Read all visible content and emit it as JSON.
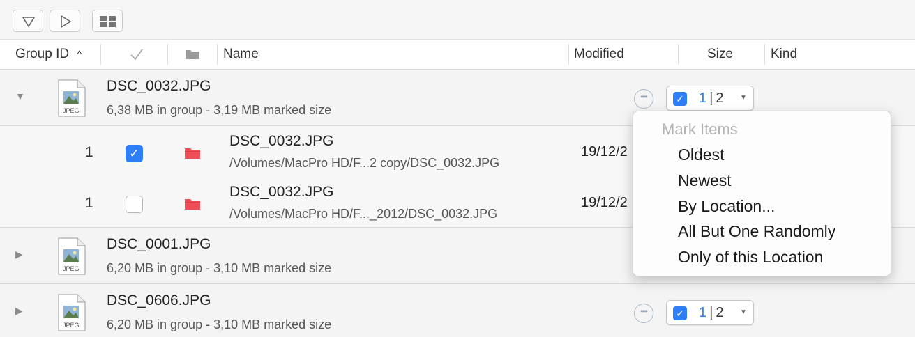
{
  "toolbar": {
    "buttons": [
      {
        "name": "filter-triangle-down-icon"
      },
      {
        "name": "play-triangle-right-icon"
      },
      {
        "name": "grid-view-icon"
      }
    ]
  },
  "header": {
    "group_id": "Group ID",
    "sort_indicator": "^",
    "check_icon": "checkmark-icon",
    "folder_icon": "folder-icon",
    "name": "Name",
    "modified": "Modified",
    "size": "Size",
    "kind": "Kind"
  },
  "groups": [
    {
      "name": "DSC_0032.JPG",
      "summary": "6,38 MB in group - 3,19 MB marked size",
      "expanded": true,
      "marked": "1",
      "separator": "|",
      "total": "2",
      "file_icon_label": "JPEG",
      "items": [
        {
          "group_id": "1",
          "checked": true,
          "name": "DSC_0032.JPG",
          "path": "/Volumes/MacPro HD/F...2 copy/DSC_0032.JPG",
          "modified": "19/12/2"
        },
        {
          "group_id": "1",
          "checked": false,
          "name": "DSC_0032.JPG",
          "path": "/Volumes/MacPro HD/F..._2012/DSC_0032.JPG",
          "modified": "19/12/2"
        }
      ]
    },
    {
      "name": "DSC_0001.JPG",
      "summary": "6,20 MB in group - 3,10 MB marked size",
      "expanded": false,
      "file_icon_label": "JPEG"
    },
    {
      "name": "DSC_0606.JPG",
      "summary": "6,20 MB in group - 3,10 MB marked size",
      "expanded": false,
      "marked": "1",
      "separator": "|",
      "total": "2",
      "file_icon_label": "JPEG"
    }
  ],
  "mark_menu": {
    "title": "Mark Items",
    "items": [
      "Oldest",
      "Newest",
      "By Location...",
      "All But One Randomly",
      "Only of this Location"
    ]
  },
  "colors": {
    "accent": "#2e7ef7",
    "folder": "#f04e57",
    "group_row_bg": "#f4f4f4"
  }
}
